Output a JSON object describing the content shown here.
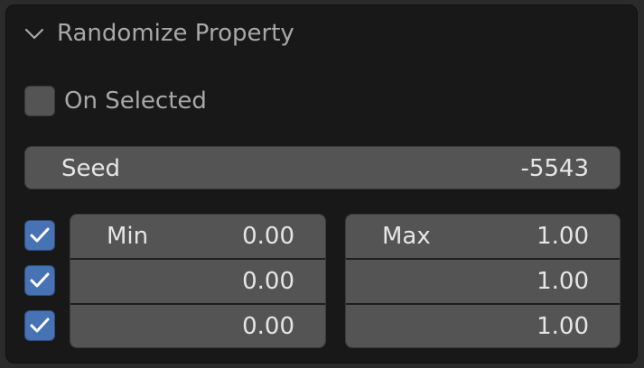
{
  "header": {
    "title": "Randomize Property",
    "icon": "chevron-down-icon"
  },
  "on_selected": {
    "label": "On Selected",
    "checked": false
  },
  "seed": {
    "label": "Seed",
    "value": "-5543"
  },
  "axes": [
    {
      "enabled": true,
      "min": "0.00",
      "max": "1.00"
    },
    {
      "enabled": true,
      "min": "0.00",
      "max": "1.00"
    },
    {
      "enabled": true,
      "min": "0.00",
      "max": "1.00"
    }
  ],
  "min_label": "Min",
  "max_label": "Max",
  "colors": {
    "panel_bg": "#181818",
    "field_bg": "#545454",
    "accent": "#4772b3",
    "text": "#e6e6e6",
    "muted_text": "#a8a8a8"
  }
}
